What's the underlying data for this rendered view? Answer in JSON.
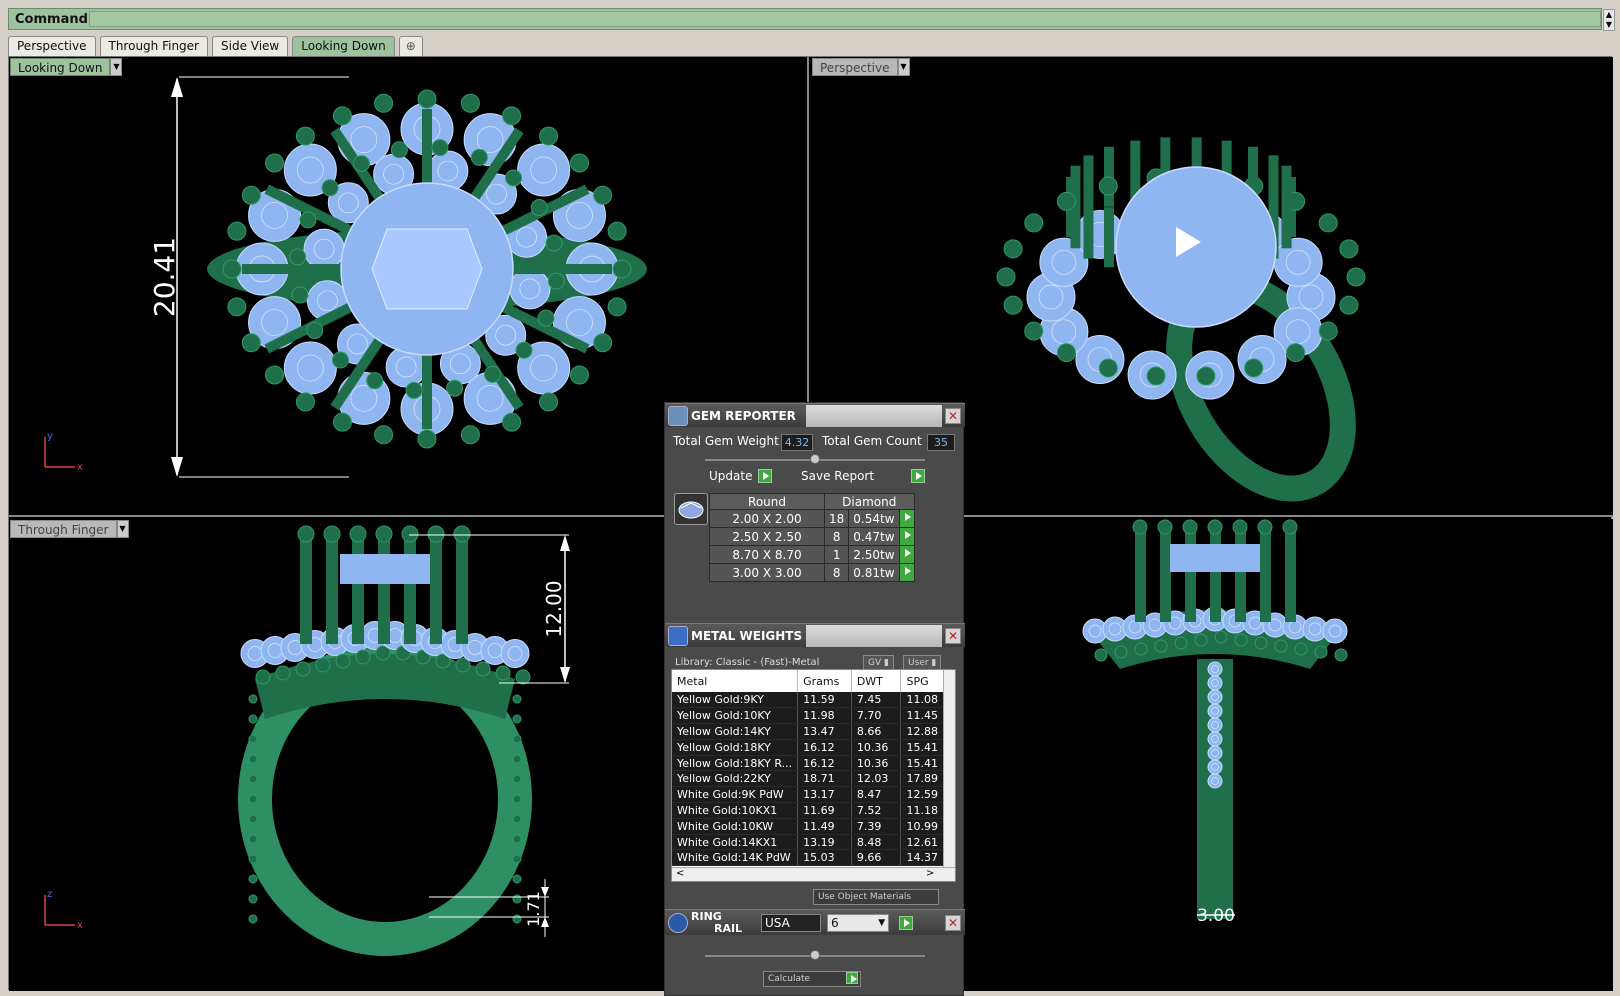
{
  "command": {
    "label": "Command:"
  },
  "tabs": [
    "Perspective",
    "Through Finger",
    "Side View",
    "Looking Down"
  ],
  "tab_add_icon": "plus-icon",
  "viewports": {
    "top_left": {
      "label": "Looking Down",
      "dimension": "20.41",
      "axes": [
        "y",
        "x"
      ]
    },
    "top_right": {
      "label": "Perspective"
    },
    "bottom_left": {
      "label": "Through Finger",
      "dimension_top": "12.00",
      "dimension_bottom": "1.71",
      "axes": [
        "z",
        "x"
      ]
    },
    "bottom_right": {
      "dimension": "3.00"
    }
  },
  "colors": {
    "metal": "#1e6f4a",
    "gem": "#8fb6f0",
    "viewport_bg": "#000000",
    "label_bg": "#9ec29e"
  },
  "gem_reporter": {
    "title": "GEM REPORTER",
    "total_weight_label": "Total Gem Weight",
    "total_weight": "4.32",
    "total_count_label": "Total Gem Count",
    "total_count": "35",
    "update_label": "Update",
    "save_label": "Save Report",
    "shape": "Round",
    "material": "Diamond",
    "rows": [
      {
        "size": "2.00 X 2.00",
        "count": "18",
        "weight": "0.54tw"
      },
      {
        "size": "2.50 X 2.50",
        "count": "8",
        "weight": "0.47tw"
      },
      {
        "size": "8.70 X 8.70",
        "count": "1",
        "weight": "2.50tw"
      },
      {
        "size": "3.00 X 3.00",
        "count": "8",
        "weight": "0.81tw"
      }
    ]
  },
  "metal_weights": {
    "title": "METAL WEIGHTS",
    "library": "Library: Classic - (Fast)-Metal",
    "gv_label": "GV",
    "user_label": "User",
    "columns": [
      "Metal",
      "Grams",
      "DWT",
      "SPG"
    ],
    "rows": [
      [
        "Yellow Gold:9KY",
        "11.59",
        "7.45",
        "11.08"
      ],
      [
        "Yellow Gold:10KY",
        "11.98",
        "7.70",
        "11.45"
      ],
      [
        "Yellow Gold:14KY",
        "13.47",
        "8.66",
        "12.88"
      ],
      [
        "Yellow Gold:18KY",
        "16.12",
        "10.36",
        "15.41"
      ],
      [
        "Yellow Gold:18KY R...",
        "16.12",
        "10.36",
        "15.41"
      ],
      [
        "Yellow Gold:22KY",
        "18.71",
        "12.03",
        "17.89"
      ],
      [
        "White Gold:9K PdW",
        "13.17",
        "8.47",
        "12.59"
      ],
      [
        "White Gold:10KX1",
        "11.69",
        "7.52",
        "11.18"
      ],
      [
        "White Gold:10KW",
        "11.49",
        "7.39",
        "10.99"
      ],
      [
        "White Gold:14KX1",
        "13.19",
        "8.48",
        "12.61"
      ],
      [
        "White Gold:14K PdW",
        "15.03",
        "9.66",
        "14.37"
      ]
    ],
    "use_object_materials": "Use Object Materials"
  },
  "ring_rail": {
    "title_line1": "RING",
    "title_line2": "RAIL",
    "standard": "USA",
    "size": "6",
    "calculate_label": "Calculate"
  }
}
